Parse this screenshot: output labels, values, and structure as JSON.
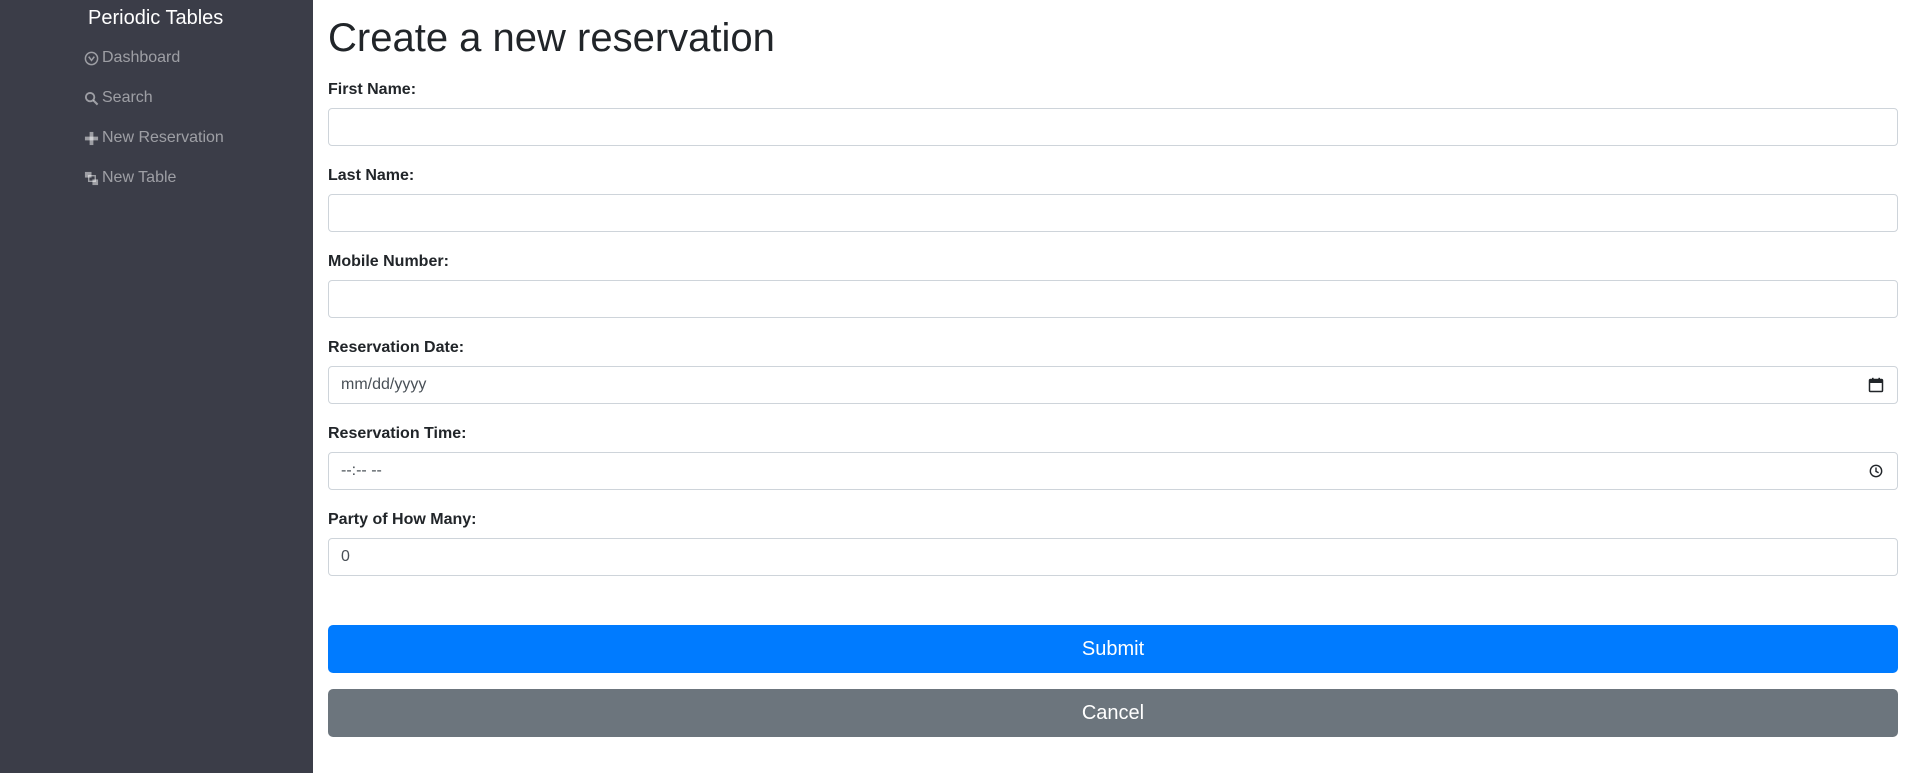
{
  "sidebar": {
    "brand": "Periodic Tables",
    "items": [
      {
        "label": "Dashboard",
        "icon": "dashboard-icon"
      },
      {
        "label": "Search",
        "icon": "search-icon"
      },
      {
        "label": "New Reservation",
        "icon": "plus-icon"
      },
      {
        "label": "New Table",
        "icon": "tables-icon"
      }
    ]
  },
  "form": {
    "title": "Create a new reservation",
    "fields": [
      {
        "label": "First Name:",
        "value": "",
        "placeholder": ""
      },
      {
        "label": "Last Name:",
        "value": "",
        "placeholder": ""
      },
      {
        "label": "Mobile Number:",
        "value": "",
        "placeholder": ""
      },
      {
        "label": "Reservation Date:",
        "value": "",
        "placeholder": "mm/dd/yyyy",
        "icon": "calendar-icon"
      },
      {
        "label": "Reservation Time:",
        "value": "",
        "placeholder": "--:-- --",
        "icon": "clock-icon"
      },
      {
        "label": "Party of How Many:",
        "value": "0",
        "placeholder": ""
      }
    ],
    "submit_label": "Submit",
    "cancel_label": "Cancel"
  },
  "colors": {
    "sidebar_bg": "#3b3d48",
    "primary": "#007bff",
    "secondary": "#6c757d"
  }
}
